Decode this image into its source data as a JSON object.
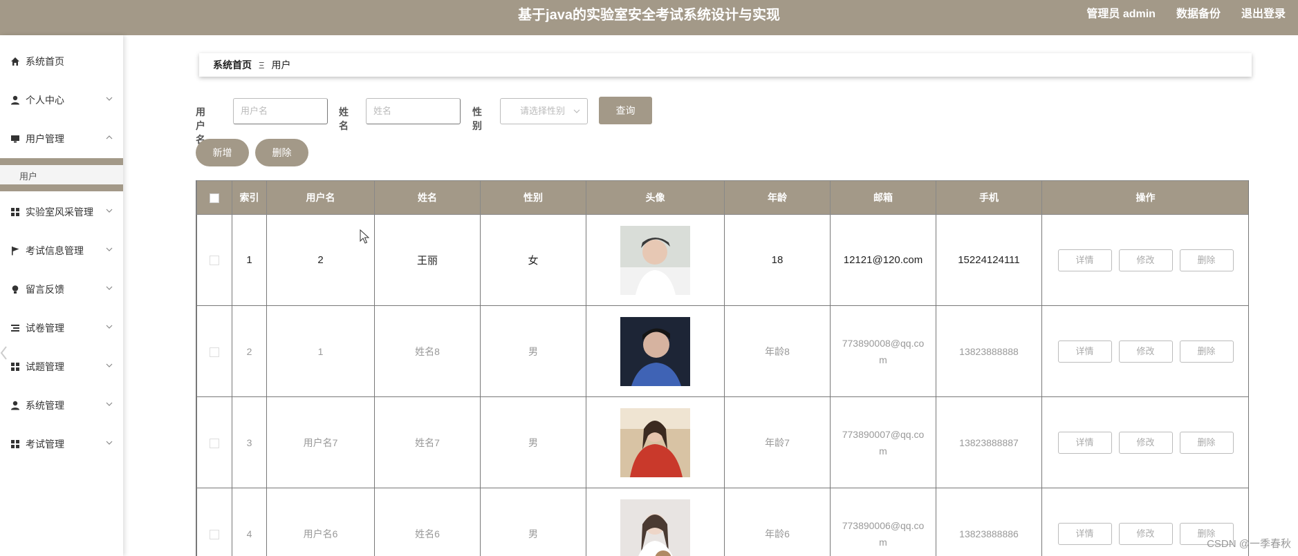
{
  "header": {
    "title": "基于java的实验室安全考试系统设计与实现",
    "user": "管理员 admin",
    "backup": "数据备份",
    "logout": "退出登录",
    "colors": {
      "primary": "#a39988",
      "white": "#ffffff"
    }
  },
  "sidebar": {
    "items": [
      {
        "label": "系统首页",
        "icon": "home-icon"
      },
      {
        "label": "个人中心",
        "icon": "user-icon"
      },
      {
        "label": "用户管理",
        "icon": "monitor-icon"
      },
      {
        "label": "实验室风采管理",
        "icon": "grid-icon"
      },
      {
        "label": "考试信息管理",
        "icon": "flag-icon"
      },
      {
        "label": "留言反馈",
        "icon": "bulb-icon"
      },
      {
        "label": "试卷管理",
        "icon": "list-icon"
      },
      {
        "label": "试题管理",
        "icon": "grid-icon"
      },
      {
        "label": "系统管理",
        "icon": "user-icon"
      },
      {
        "label": "考试管理",
        "icon": "grid-icon"
      }
    ],
    "sub_item": "用户"
  },
  "breadcrumb": {
    "home": "系统首页",
    "separator": "Ξ",
    "current": "用户"
  },
  "search": {
    "username_label": "用户名",
    "username_placeholder": "用户名",
    "name_label": "姓名",
    "name_placeholder": "姓名",
    "gender_label": "性别",
    "gender_placeholder": "请选择性别",
    "query": "查询"
  },
  "actions": {
    "add": "新增",
    "delete": "删除"
  },
  "table": {
    "headers": [
      "索引",
      "用户名",
      "姓名",
      "性别",
      "头像",
      "年龄",
      "邮箱",
      "手机",
      "操作"
    ],
    "ops": {
      "detail": "详情",
      "edit": "修改",
      "delete": "删除"
    },
    "rows": [
      {
        "index": "1",
        "username": "2",
        "name": "王丽",
        "gender": "女",
        "age": "18",
        "email": "12121@120.com",
        "phone": "15224124111"
      },
      {
        "index": "2",
        "username": "1",
        "name": "姓名8",
        "gender": "男",
        "age": "年龄8",
        "email": "773890008@qq.com",
        "phone": "13823888888"
      },
      {
        "index": "3",
        "username": "用户名7",
        "name": "姓名7",
        "gender": "男",
        "age": "年龄7",
        "email": "773890007@qq.com",
        "phone": "13823888887"
      },
      {
        "index": "4",
        "username": "用户名6",
        "name": "姓名6",
        "gender": "男",
        "age": "年龄6",
        "email": "773890006@qq.com",
        "phone": "13823888886"
      }
    ]
  },
  "watermark": "CSDN @一季春秋"
}
